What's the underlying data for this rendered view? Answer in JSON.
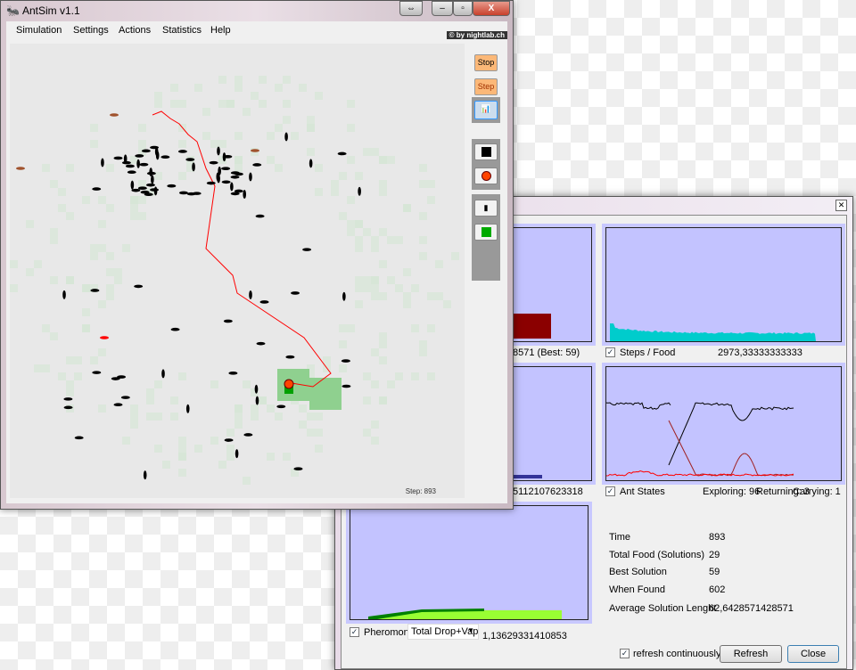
{
  "main_window": {
    "title": "AntSim v1.1",
    "credit": "© by nightlab.ch",
    "menu": [
      "Simulation",
      "Settings",
      "Actions",
      "Statistics",
      "Help"
    ],
    "toolbar": {
      "stop": "Stop",
      "step": "Step",
      "icons": [
        "statistics-icon",
        "wall-tool-icon",
        "food-tool-icon",
        "ant-tool-icon",
        "nest-tool-icon"
      ]
    },
    "step_label": "Step: 893"
  },
  "stats_window": {
    "solution_label": "8571 (Best: 59)",
    "steps_food": {
      "label": "Steps / Food",
      "value": "2973,33333333333",
      "checked": true
    },
    "middle_left_value": "5112107623318",
    "ant_states": {
      "label": "Ant States",
      "checked": true,
      "exploring": "Exploring:  96",
      "returning": "Returning:  3",
      "carrying": "Carrying:  1"
    },
    "pheromone": {
      "label": "Pheromone",
      "checked": true,
      "select": "Total Drop+Vap",
      "value": "1,13629331410853"
    },
    "summary": [
      {
        "k": "Time",
        "v": "893"
      },
      {
        "k": "Total Food (Solutions)",
        "v": "29"
      },
      {
        "k": "Best Solution",
        "v": "59"
      },
      {
        "k": "When Found",
        "v": "602"
      },
      {
        "k": "Average Solution Lenght",
        "v": "62,6428571428571"
      }
    ],
    "refresh_continuously": {
      "label": "refresh continuously",
      "checked": true
    },
    "refresh_button": "Refresh",
    "close_button": "Close"
  },
  "colors": {
    "chart_bg": "#c3c3ff",
    "trail": "#ff0000",
    "ant": "#000000",
    "food": "#ff4400",
    "nest": "#00a000"
  }
}
